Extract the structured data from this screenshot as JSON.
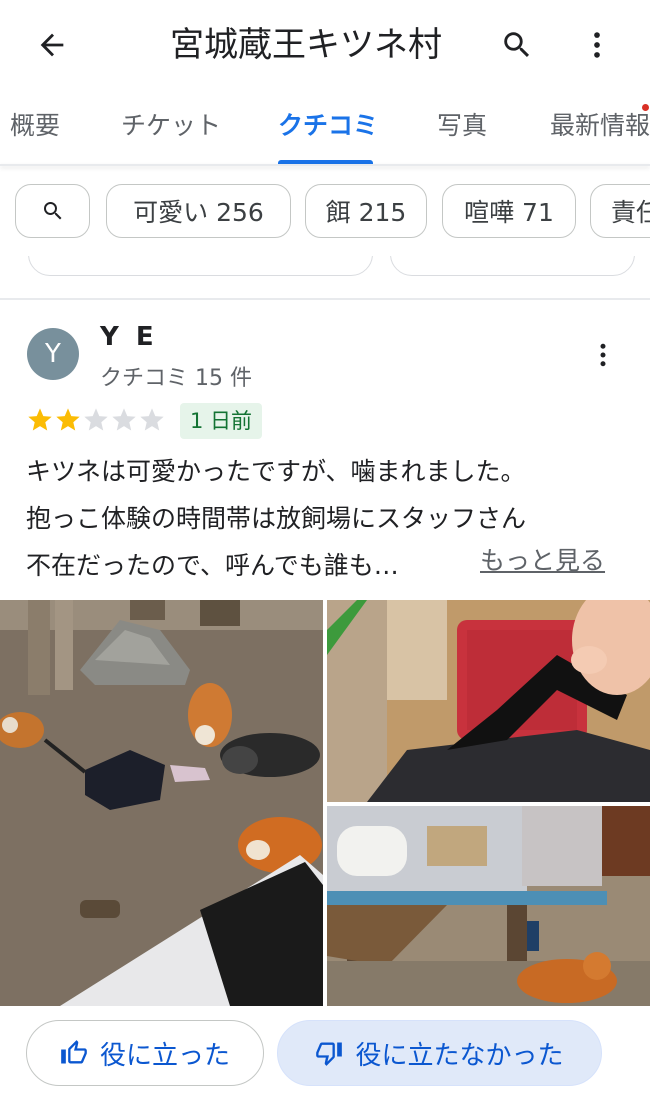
{
  "header": {
    "title": "宮城蔵王キツネ村",
    "icons": [
      "back-arrow-icon",
      "search-icon",
      "more-vert-icon"
    ]
  },
  "tabs": [
    {
      "label": "概要",
      "active": false
    },
    {
      "label": "チケット",
      "active": false
    },
    {
      "label": "クチコミ",
      "active": true
    },
    {
      "label": "写真",
      "active": false
    },
    {
      "label": "最新情報",
      "active": false
    }
  ],
  "chips": [
    {
      "label": "可愛い 256"
    },
    {
      "label": "餌 215"
    },
    {
      "label": "喧嘩 71"
    },
    {
      "label": "責任"
    }
  ],
  "review": {
    "avatar_letter": "Y",
    "avatar_color": "#78909c",
    "name": "Y E",
    "meta": "クチコミ 15 件",
    "rating": 2,
    "rating_max": 5,
    "date": "1 日前",
    "text_lines": [
      "キツネは可愛かったですが、噛まれました。",
      "抱っこ体験の時間帯は放飼場にスタッフさん",
      "不在だったので、呼んでも誰も…"
    ],
    "more_label": "もっと見る",
    "photos": [
      {
        "icon": "photo-foxes-in-enclosure"
      },
      {
        "icon": "photo-bag-handle"
      },
      {
        "icon": "photo-fox-cages"
      }
    ]
  },
  "actions": {
    "helpful_label": "役に立った",
    "not_helpful_label": "役に立たなかった"
  },
  "colors": {
    "accent": "#1a73e8",
    "star_filled": "#fbbc04",
    "star_empty": "#dadce0",
    "badge_bg": "#e6f4ea",
    "badge_text": "#137333"
  }
}
